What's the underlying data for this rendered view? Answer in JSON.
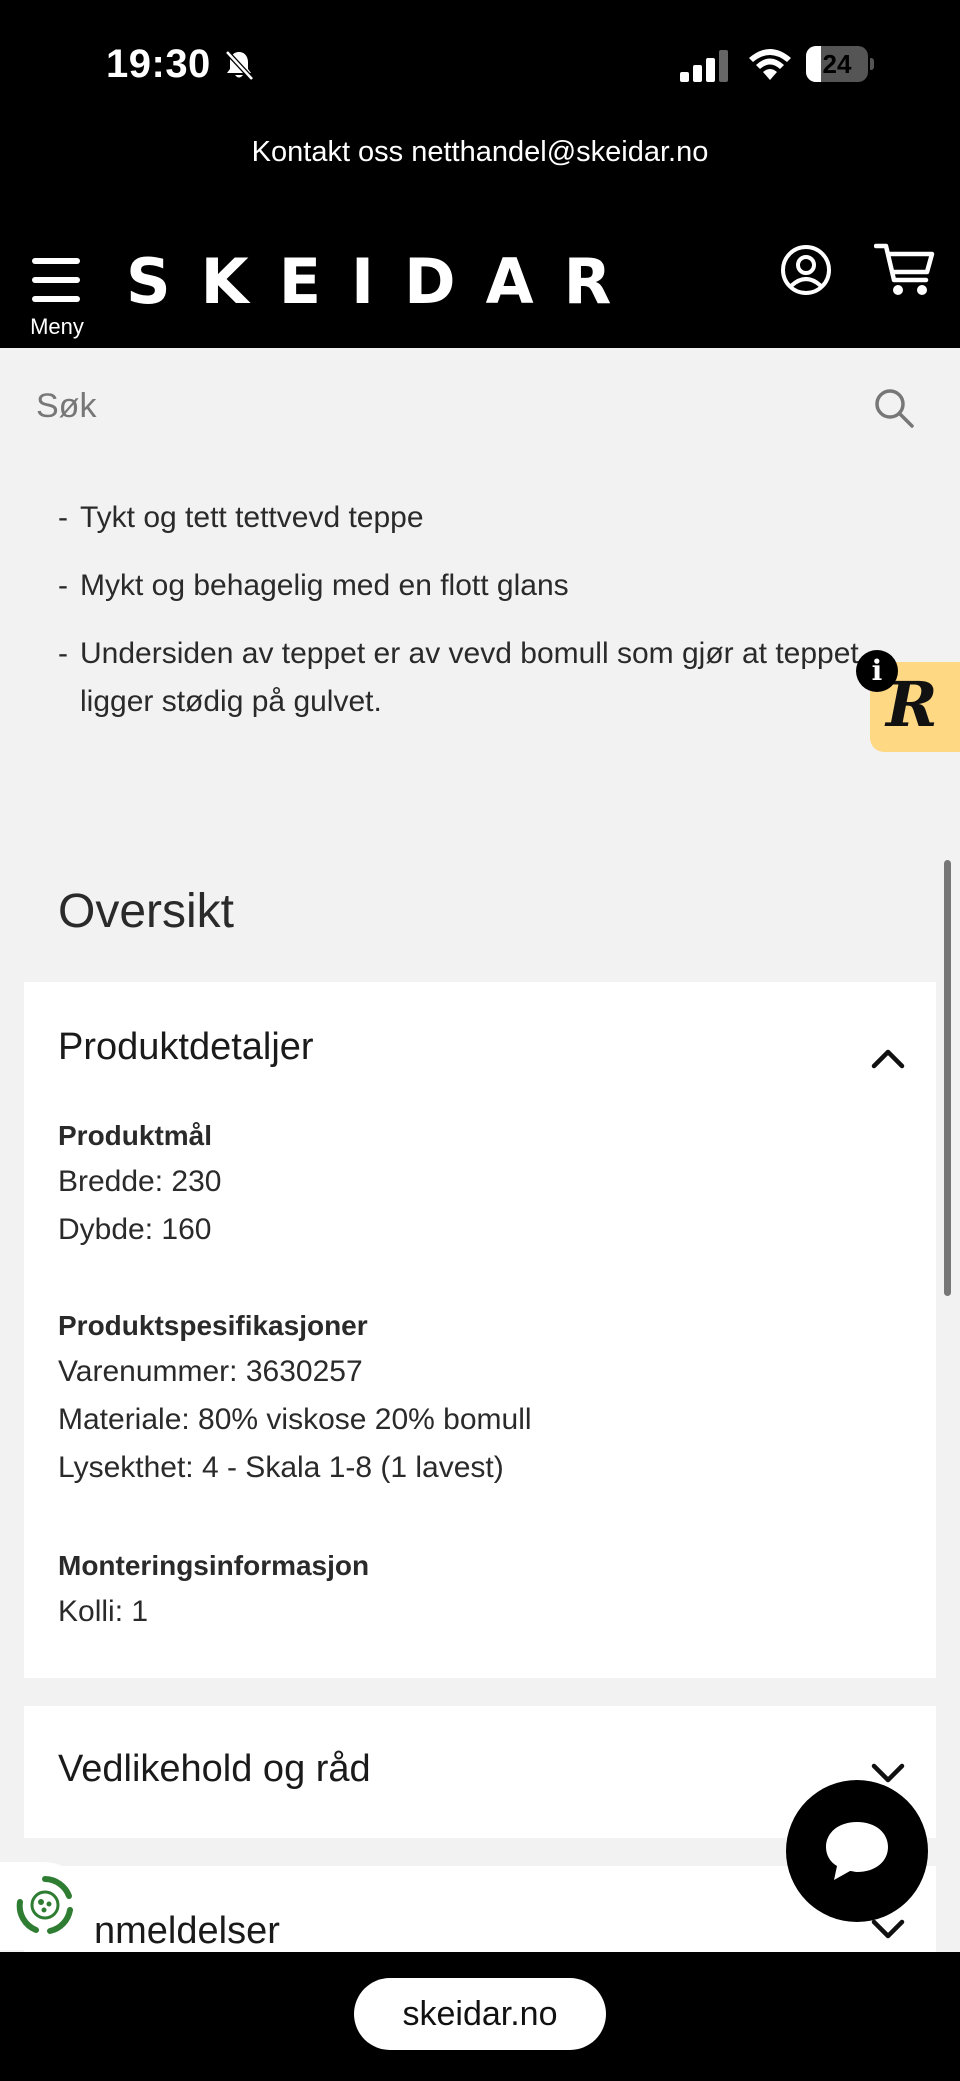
{
  "status_bar": {
    "time": "19:30",
    "battery": "24",
    "battery_level": 0.24,
    "icons": [
      "bell-muted-icon",
      "cellular-signal-icon",
      "wifi-icon",
      "battery-icon"
    ]
  },
  "contact_bar": {
    "text": "Kontakt oss netthandel@skeidar.no"
  },
  "header": {
    "menu_label": "Meny",
    "logo": "SKEIDAR",
    "icons": [
      "hamburger-menu-icon",
      "account-icon",
      "cart-icon"
    ]
  },
  "search": {
    "placeholder": "Søk",
    "value": ""
  },
  "description": {
    "bullets": [
      "Tykt og tett tettvevd teppe",
      "Mykt og behagelig med en flott glans",
      "Undersiden av teppet er av vevd bomull som gjør at teppet ligger stødig på gulvet."
    ]
  },
  "overview": {
    "title": "Oversikt",
    "details_panel": {
      "title": "Produktdetaljer",
      "expanded": true,
      "dimensions": {
        "heading": "Produktmål",
        "lines": [
          "Bredde: 230",
          "Dybde: 160"
        ]
      },
      "specs": {
        "heading": "Produktspesifikasjoner",
        "lines": [
          "Varenummer: 3630257",
          "Materiale: 80% viskose 20% bomull",
          "Lysekthet: 4 - Skala 1-8 (1 lavest)"
        ]
      },
      "assembly": {
        "heading": "Monteringsinformasjon",
        "lines": [
          "Kolli: 1"
        ]
      }
    },
    "care_panel": {
      "title": "Vedlikehold og råd",
      "expanded": false
    },
    "reviews_panel": {
      "title": "nmeldelser",
      "expanded": false
    }
  },
  "badge": {
    "letter": "R",
    "info": "i"
  },
  "url_bar": {
    "url": "skeidar.no"
  },
  "colors": {
    "header_bg": "#000000",
    "page_bg": "#f2f2f2",
    "badge_bg": "#ffd883",
    "recycle_green": "#2e7d32"
  }
}
